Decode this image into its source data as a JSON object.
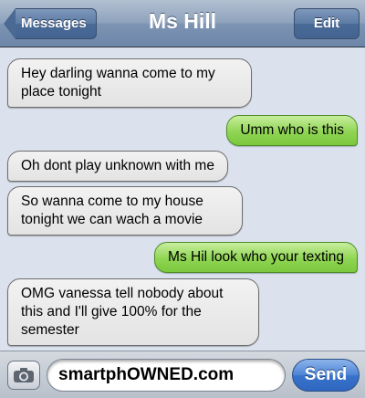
{
  "header": {
    "title": "Ms Hill",
    "back_label": "Messages",
    "edit_label": "Edit"
  },
  "messages": [
    {
      "direction": "incoming",
      "text": "Hey darling wanna come to my place tonight"
    },
    {
      "direction": "outgoing",
      "text": "Umm who is this"
    },
    {
      "direction": "incoming",
      "text": "Oh dont play unknown with me"
    },
    {
      "direction": "incoming",
      "text": "So wanna come to my house tonight we can wach a movie"
    },
    {
      "direction": "outgoing",
      "text": "Ms Hil look who your texting"
    },
    {
      "direction": "incoming",
      "text": "OMG vanessa tell nobody about this and I'll give 100% for the semester"
    }
  ],
  "composer": {
    "input_value": "smartphOWNED.com",
    "send_label": "Send",
    "camera_icon": "camera-icon"
  },
  "colors": {
    "incoming_bubble": "#e9e9e9",
    "outgoing_bubble": "#8fd553",
    "nav_bar": "#7d94b3",
    "send_button": "#3a73cb"
  }
}
